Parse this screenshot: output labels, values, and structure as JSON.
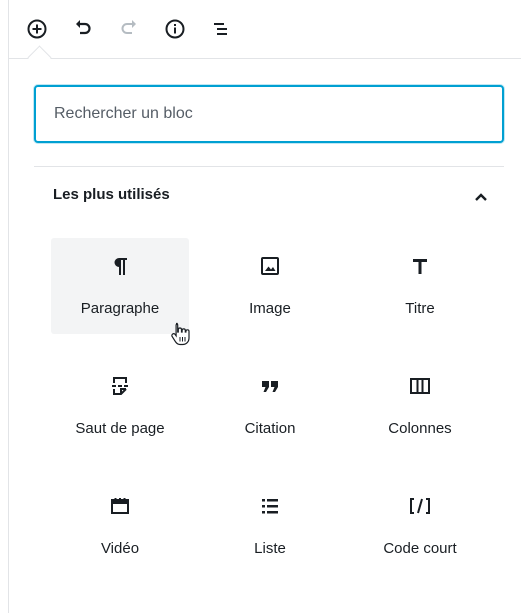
{
  "search": {
    "placeholder": "Rechercher un bloc"
  },
  "panel": {
    "title": "Les plus utilisés"
  },
  "blocks": [
    {
      "label": "Paragraphe",
      "icon": "paragraph-icon"
    },
    {
      "label": "Image",
      "icon": "image-icon"
    },
    {
      "label": "Titre",
      "icon": "heading-icon"
    },
    {
      "label": "Saut de page",
      "icon": "page-break-icon"
    },
    {
      "label": "Citation",
      "icon": "quote-icon"
    },
    {
      "label": "Colonnes",
      "icon": "columns-icon"
    },
    {
      "label": "Vidéo",
      "icon": "video-icon"
    },
    {
      "label": "Liste",
      "icon": "list-icon"
    },
    {
      "label": "Code court",
      "icon": "shortcode-icon"
    }
  ],
  "colors": {
    "accent": "#00a0d2",
    "text": "#191e23",
    "border": "#e2e4e7",
    "hover": "#f3f4f5"
  }
}
